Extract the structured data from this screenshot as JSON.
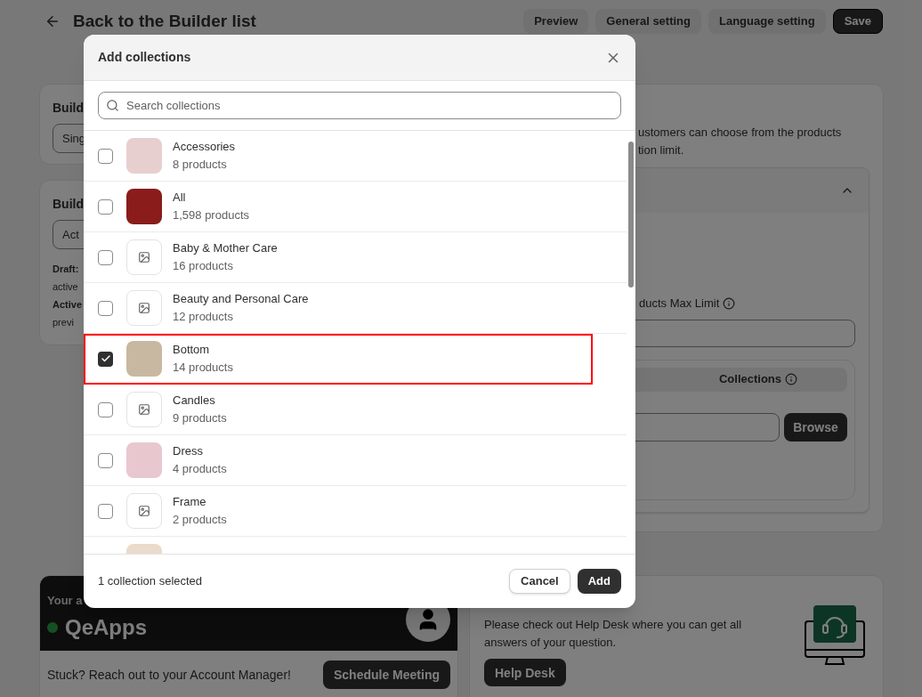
{
  "page": {
    "back_title": "Back to the Builder list",
    "actions": [
      {
        "label": "Preview",
        "kind": "secondary"
      },
      {
        "label": "General setting",
        "kind": "secondary"
      },
      {
        "label": "Language setting",
        "kind": "secondary"
      },
      {
        "label": "Save",
        "kind": "primary"
      }
    ],
    "left_card_1": {
      "title": "Build",
      "select_value": "Sing"
    },
    "left_card_2": {
      "title": "Build",
      "select_value": "Act",
      "lines": [
        {
          "text": "Draft:",
          "bold": true
        },
        {
          "text": "active",
          "bold": false
        },
        {
          "text": "Active",
          "bold": true
        },
        {
          "text": "previ",
          "bold": false
        }
      ]
    },
    "right_card": {
      "description": [
        "ustomers can choose from the products",
        "tion limit."
      ],
      "max_limit_label": "ducts Max Limit",
      "tab_label": "Collections",
      "browse_button": "Browse"
    },
    "account_card": {
      "heading": "Your a",
      "name": "QeApps",
      "online": true,
      "text": "Stuck? Reach out to your Account Manager!",
      "button": "Schedule Meeting"
    },
    "help_card": {
      "text": "Please check out Help Desk where you can get all answers of your question.",
      "button": "Help Desk"
    }
  },
  "modal": {
    "title": "Add collections",
    "search": {
      "placeholder": "Search collections"
    },
    "items": [
      {
        "name": "Accessories",
        "count": "8 products",
        "kind": "photo",
        "checked": false,
        "highlighted": false
      },
      {
        "name": "All",
        "count": "1,598 products",
        "kind": "photo",
        "checked": false,
        "highlighted": false
      },
      {
        "name": "Baby & Mother Care",
        "count": "16 products",
        "kind": "placeholder",
        "checked": false,
        "highlighted": false
      },
      {
        "name": "Beauty and Personal Care",
        "count": "12 products",
        "kind": "placeholder",
        "checked": false,
        "highlighted": false
      },
      {
        "name": "Bottom",
        "count": "14 products",
        "kind": "photo",
        "checked": true,
        "highlighted": true
      },
      {
        "name": "Candles",
        "count": "9 products",
        "kind": "placeholder",
        "checked": false,
        "highlighted": false
      },
      {
        "name": "Dress",
        "count": "4 products",
        "kind": "photo",
        "checked": false,
        "highlighted": false
      },
      {
        "name": "Frame",
        "count": "2 products",
        "kind": "placeholder",
        "checked": false,
        "highlighted": false
      }
    ],
    "footer_text": "1 collection selected",
    "cancel": "Cancel",
    "add": "Add"
  }
}
